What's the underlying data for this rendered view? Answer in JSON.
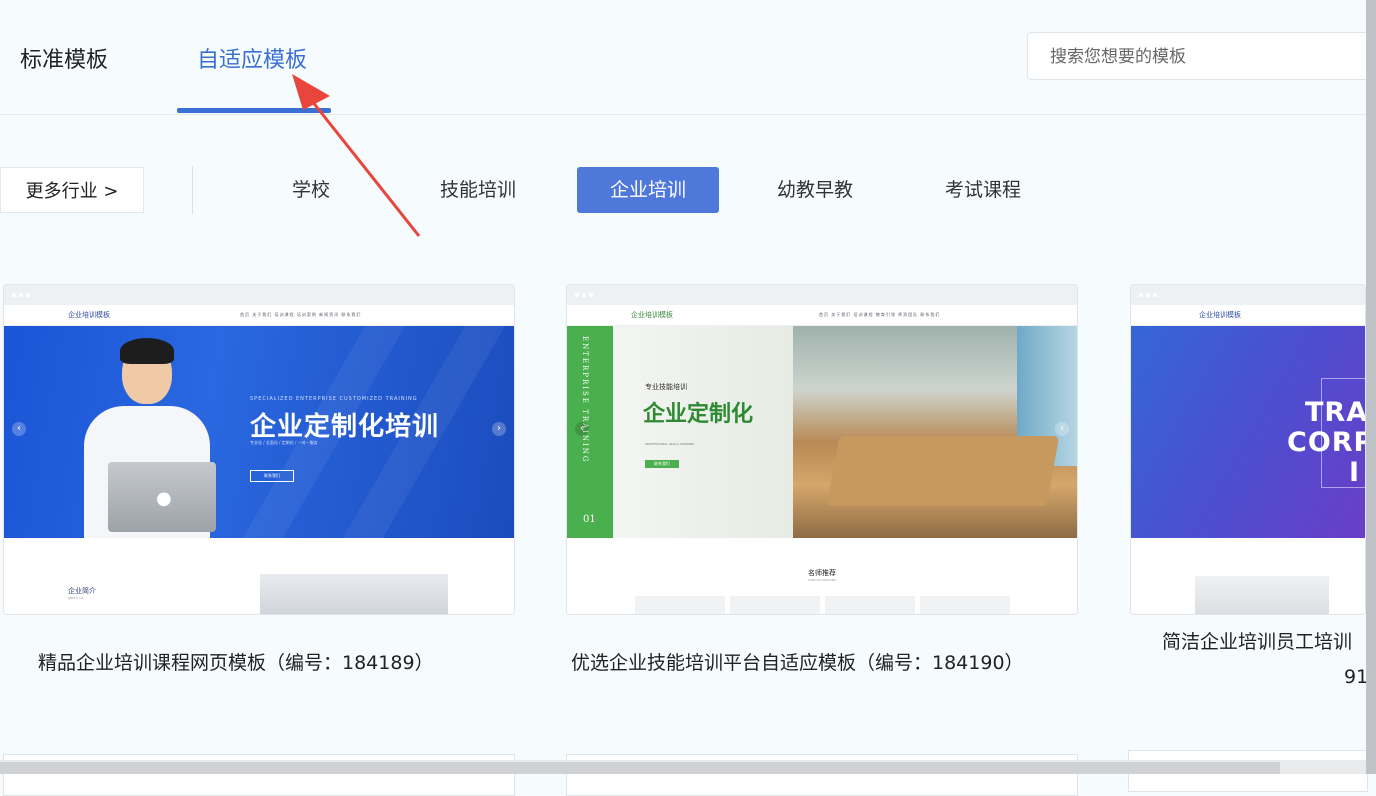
{
  "tabs": [
    {
      "label": "标准模板",
      "active": false
    },
    {
      "label": "自适应模板",
      "active": true
    }
  ],
  "search": {
    "placeholder": "搜索您想要的模板",
    "value": ""
  },
  "filters": {
    "more_label": "更多行业 >",
    "categories": [
      {
        "label": "学校",
        "active": false
      },
      {
        "label": "技能培训",
        "active": false
      },
      {
        "label": "企业培训",
        "active": true
      },
      {
        "label": "幼教早教",
        "active": false
      },
      {
        "label": "考试课程",
        "active": false
      }
    ]
  },
  "cards": [
    {
      "title": "精品企业培训课程网页模板（编号：184189）",
      "preview": {
        "brand": "企业培训模板",
        "nav": "首页   关于我们   培训课程   培训案例   新闻资讯   联系我们",
        "sub": "SPECIALIZED ENTERPRISE CUSTOMIZED TRAINING",
        "headline": "企业定制化培训",
        "tagline": "专业化 / 全面化 / 定制化 / 一对一服务",
        "button": "联系我们",
        "section": "企业简介",
        "section_sub": "ABOUT US"
      }
    },
    {
      "title": "优选企业技能培训平台自适应模板（编号：184190）",
      "preview": {
        "brand": "企业培训模板",
        "nav": "首页   关于我们   培训课程   教育引领   师资团队   联系我们",
        "side": "ENTERPRISE TRAINING",
        "side_num": "01",
        "pre": "专业技能培训",
        "headline": "企业定制化",
        "en": "PROFESSIONAL SKILLS TRAINING",
        "button": "联系我们",
        "section": "名师推荐",
        "section_sub": "FAMOUS TEACHER"
      }
    },
    {
      "title": "简洁企业培训员工培训",
      "id_fragment": "91",
      "preview": {
        "brand": "企业培训模板",
        "headline_lines": [
          "TRA",
          "CORP",
          "I"
        ]
      }
    }
  ],
  "colors": {
    "accent": "#3a6fd3",
    "active_filter": "#4f78db",
    "annotation_arrow": "#e8453c",
    "page_bg": "#f6fbfd"
  }
}
